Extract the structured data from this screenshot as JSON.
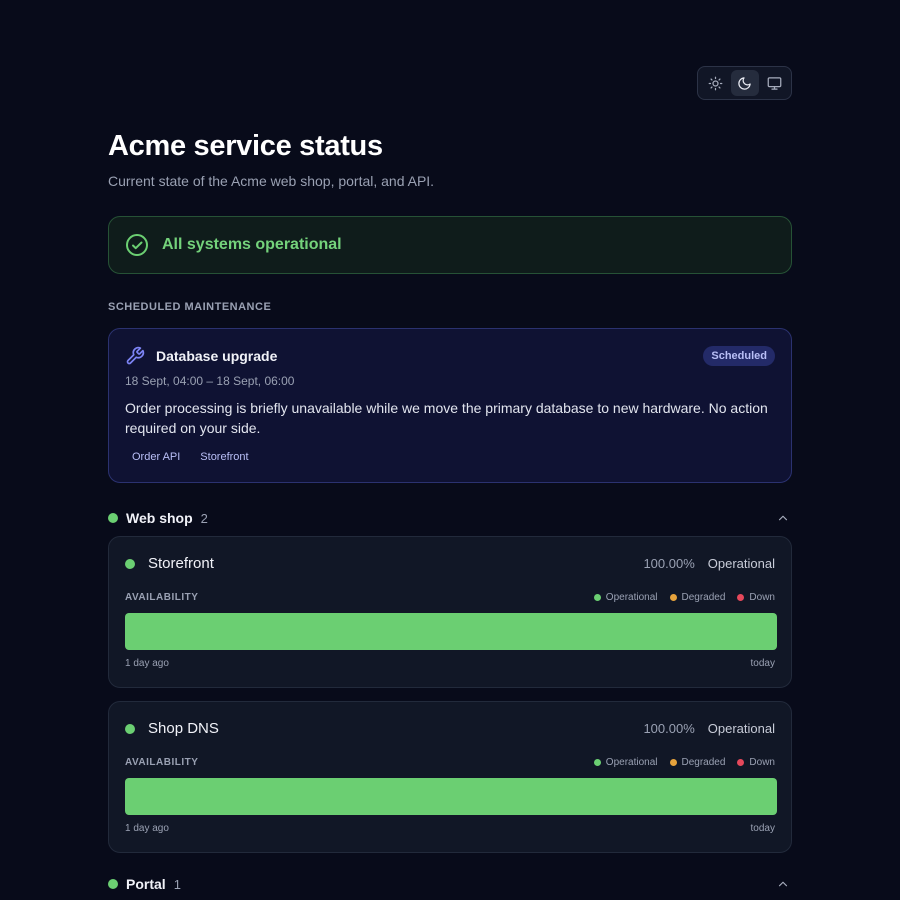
{
  "theme_switch": {
    "options": [
      {
        "icon": "sun-icon",
        "label": "Light"
      },
      {
        "icon": "moon-icon",
        "label": "Dark",
        "active": true
      },
      {
        "icon": "monitor-icon",
        "label": "System"
      }
    ]
  },
  "header": {
    "title": "Acme service status",
    "subtitle": "Current state of the Acme web shop, portal, and API."
  },
  "overall": {
    "icon": "check-circle-icon",
    "text": "All systems operational",
    "color": "#6bcf72"
  },
  "maintenance": {
    "section_label": "SCHEDULED MAINTENANCE",
    "items": [
      {
        "icon": "wrench-icon",
        "title": "Database upgrade",
        "badge": "Scheduled",
        "time": "18 Sept, 04:00 – 18 Sept, 06:00",
        "description": "Order processing is briefly unavailable while we move the primary database to new hardware. No action required on your side.",
        "tags": [
          "Order API",
          "Storefront"
        ]
      }
    ]
  },
  "legend": {
    "operational": "Operational",
    "degraded": "Degraded",
    "down": "Down",
    "colors": {
      "operational": "#6bcf72",
      "degraded": "#e6a23c",
      "down": "#e5485b"
    }
  },
  "groups": [
    {
      "name": "Web shop",
      "count": "2",
      "icon": "chevron-up-icon",
      "services": [
        {
          "name": "Storefront",
          "uptime": "100.00%",
          "state": "Operational",
          "availability_label": "AVAILABILITY",
          "availability_fraction": 1.0,
          "range_start": "1 day ago",
          "range_end": "today"
        },
        {
          "name": "Shop DNS",
          "uptime": "100.00%",
          "state": "Operational",
          "availability_label": "AVAILABILITY",
          "availability_fraction": 1.0,
          "range_start": "1 day ago",
          "range_end": "today"
        }
      ]
    },
    {
      "name": "Portal",
      "count": "1",
      "icon": "chevron-up-icon",
      "services": []
    }
  ]
}
